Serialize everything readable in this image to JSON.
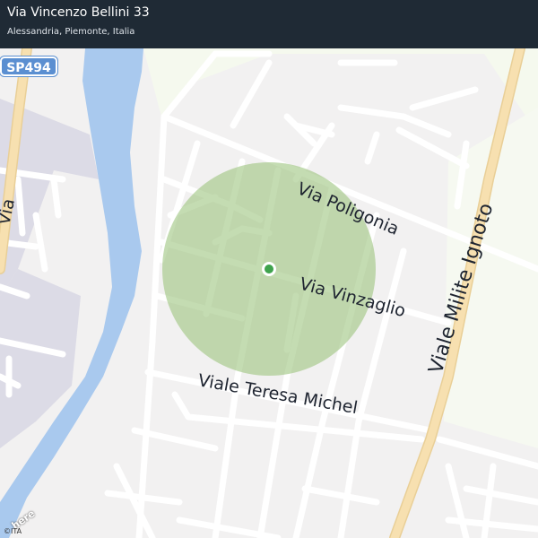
{
  "header": {
    "title": "Via Vincenzo Bellini 33",
    "subtitle": "Alessandria, Piemonte, Italia"
  },
  "map": {
    "route_shield": "SP494",
    "streets": {
      "via_poligonia": "Via  Poligonia",
      "via_vinzaglio": "Via  Vinzaglio",
      "viale_teresa_michel": "Viale  Teresa  Michel",
      "viale_milite_ignoto": "Viale  Milite  Ignoto",
      "via_partial_left": "Via"
    },
    "location_marker": "location-pin",
    "colors": {
      "accuracy_circle": "#9cc47e",
      "location_dot": "#3fa34d",
      "water": "#a9c9ee",
      "major_road": "#f7e0b0",
      "header_bg": "#1f2a35"
    }
  },
  "footer": {
    "logo": "here",
    "attribution": "©ITA"
  }
}
